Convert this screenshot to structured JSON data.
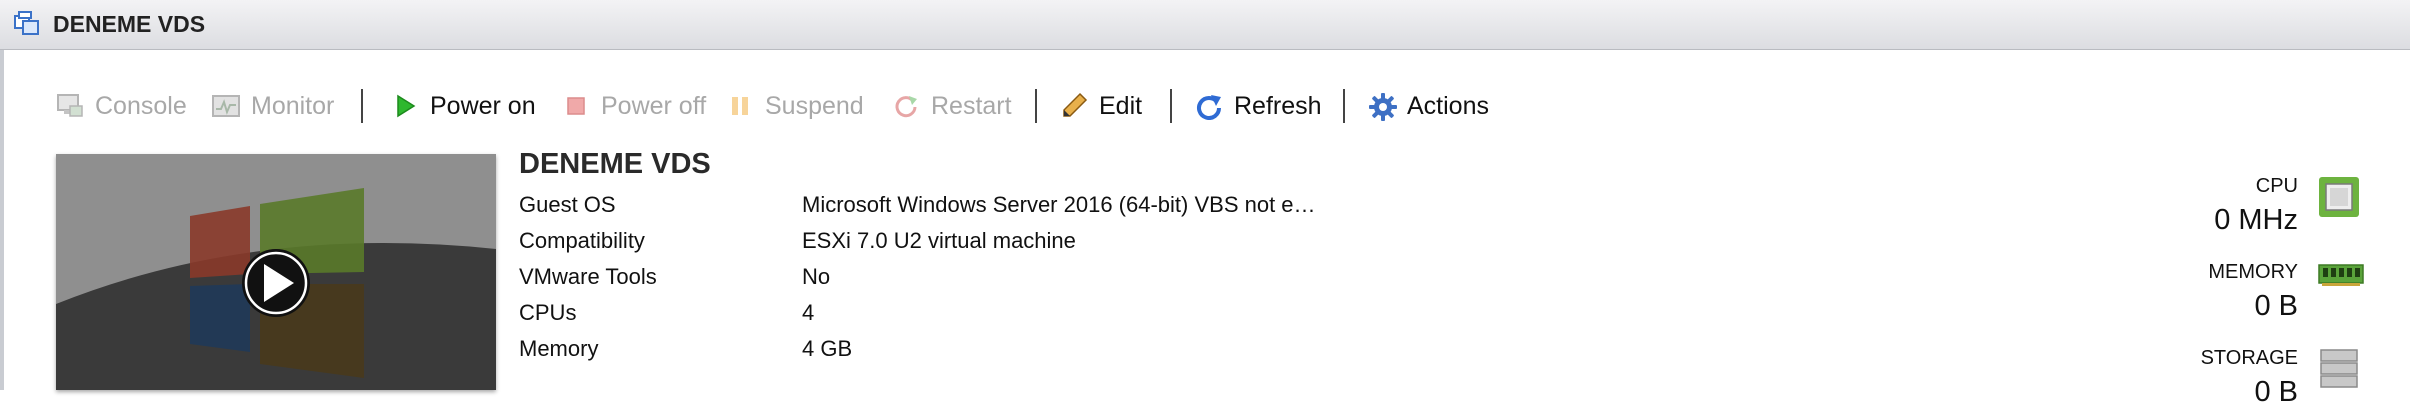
{
  "window": {
    "title": "DENEME VDS"
  },
  "toolbar": {
    "console": "Console",
    "monitor": "Monitor",
    "power_on": "Power on",
    "power_off": "Power off",
    "suspend": "Suspend",
    "restart": "Restart",
    "edit": "Edit",
    "refresh": "Refresh",
    "actions": "Actions"
  },
  "vm": {
    "name": "DENEME VDS",
    "properties": [
      {
        "label": "Guest OS",
        "value": "Microsoft Windows Server 2016 (64-bit) VBS not e…"
      },
      {
        "label": "Compatibility",
        "value": "ESXi 7.0 U2 virtual machine"
      },
      {
        "label": "VMware Tools",
        "value": "No"
      },
      {
        "label": "CPUs",
        "value": "4"
      },
      {
        "label": "Memory",
        "value": "4 GB"
      }
    ]
  },
  "resources": {
    "cpu": {
      "label": "CPU",
      "value": "0 MHz"
    },
    "memory": {
      "label": "MEMORY",
      "value": "0 B"
    },
    "storage": {
      "label": "STORAGE",
      "value": "0 B"
    }
  },
  "colors": {
    "accent_blue": "#2f6bd4",
    "power_green": "#2eb82e",
    "disabled_text": "#a8a8a8"
  }
}
